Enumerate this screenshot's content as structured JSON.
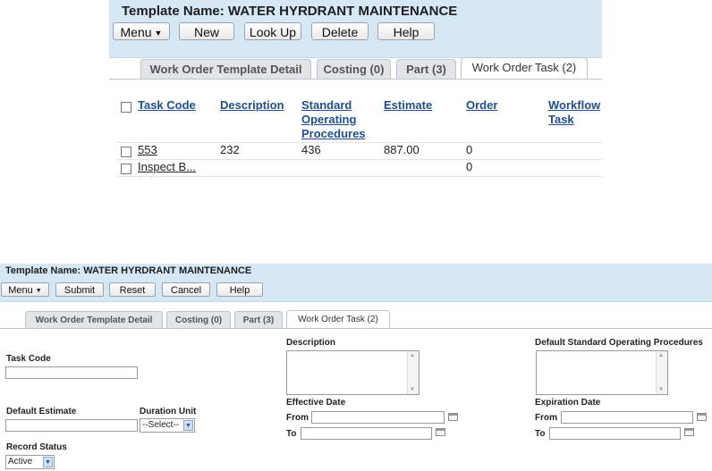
{
  "panel1": {
    "title": "Template Name: WATER HYRDRANT MAINTENANCE",
    "buttons": {
      "menu": "Menu",
      "new": "New",
      "look_up": "Look Up",
      "delete": "Delete",
      "help": "Help"
    },
    "tabs": [
      "Work Order Template Detail",
      "Costing (0)",
      "Part (3)",
      "Work Order Task (2)"
    ],
    "active_tab": "Work Order Task (2)",
    "table": {
      "headers": {
        "task_code": "Task Code",
        "description": "Description",
        "sop_line1": "Standard",
        "sop_line2": "Operating",
        "sop_line3": "Procedures",
        "estimate": "Estimate",
        "order": "Order",
        "workflow_line1": "Workflow",
        "workflow_line2": "Task"
      },
      "rows": [
        {
          "task_code": "553",
          "description": "232",
          "sop": "436",
          "estimate": "887.00",
          "order": "0",
          "workflow": ""
        },
        {
          "task_code": "Inspect B...",
          "description": "",
          "sop": "",
          "estimate": "",
          "order": "0",
          "workflow": ""
        }
      ]
    }
  },
  "panel2": {
    "title": "Template Name: WATER HYRDRANT MAINTENANCE",
    "buttons": {
      "menu": "Menu",
      "submit": "Submit",
      "reset": "Reset",
      "cancel": "Cancel",
      "help": "Help"
    },
    "tabs": [
      "Work Order Template Detail",
      "Costing (0)",
      "Part (3)",
      "Work Order Task (2)"
    ],
    "active_tab": "Work Order Task (2)",
    "form": {
      "task_code_label": "Task Code",
      "task_code_value": "",
      "description_label": "Description",
      "default_sop_label": "Default Standard Operating Procedures",
      "default_estimate_label": "Default Estimate",
      "default_estimate_value": "",
      "duration_unit_label": "Duration Unit",
      "duration_unit_value": "--Select--",
      "effective_date_label": "Effective Date",
      "expiration_date_label": "Expiration Date",
      "from_label": "From",
      "to_label": "To",
      "record_status_label": "Record Status",
      "record_status_value": "Active"
    }
  }
}
